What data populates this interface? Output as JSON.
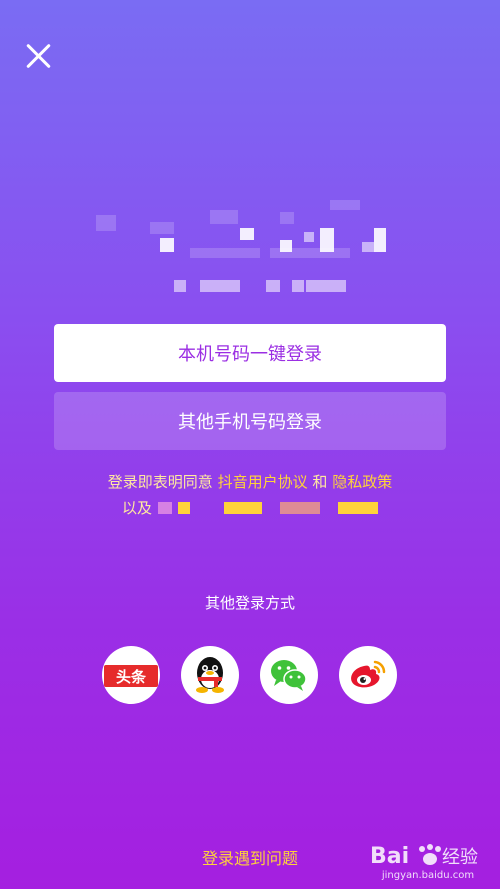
{
  "header": {
    "close_icon": "close-icon"
  },
  "login": {
    "primary_button_label": "本机号码一键登录",
    "secondary_button_label": "其他手机号码登录"
  },
  "agreement": {
    "prefix": "登录即表明同意",
    "link_user_agreement": "抖音用户协议",
    "conjunction": "和",
    "link_privacy_policy": "隐私政策",
    "line2_prefix": "以及"
  },
  "other_methods": {
    "title": "其他登录方式",
    "items": [
      {
        "name": "头条",
        "icon": "toutiao-icon",
        "color": "#e62b2b"
      },
      {
        "name": "QQ",
        "icon": "qq-icon",
        "color": "#111111"
      },
      {
        "name": "WeChat",
        "icon": "wechat-icon",
        "color": "#3fc23a"
      },
      {
        "name": "Weibo",
        "icon": "weibo-icon",
        "color": "#e6162d"
      }
    ]
  },
  "help_link": "登录遇到问题",
  "watermark": {
    "brand": "Bai",
    "brand2": "经验",
    "url": "jingyan.baidu.com"
  },
  "colors": {
    "accent": "#ffd23a",
    "primary_text": "#9b2fe3"
  }
}
